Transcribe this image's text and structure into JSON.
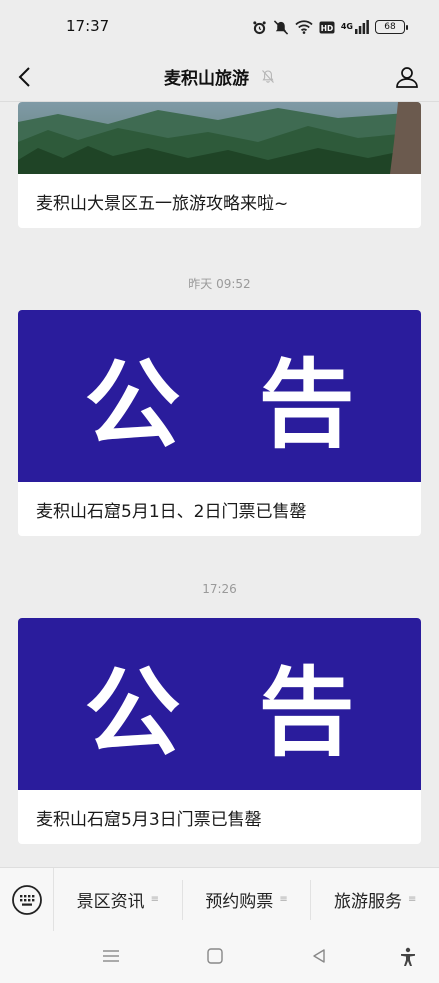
{
  "status_bar": {
    "time": "17:37",
    "network_label": "4G",
    "battery": "68",
    "icons": [
      "alarm-icon",
      "mute-icon",
      "wifi-icon",
      "hd-icon",
      "signal-icon",
      "battery-icon"
    ]
  },
  "header": {
    "title": "麦积山旅游",
    "icons": [
      "back-icon",
      "mute-bell-icon",
      "profile-icon"
    ]
  },
  "feed": [
    {
      "type": "image",
      "caption": "麦积山大景区五一旅游攻略来啦~"
    },
    {
      "timestamp": "昨天 09:52",
      "banner_left": "公",
      "banner_right": "告",
      "caption": "麦积山石窟5月1日、2日门票已售罄"
    },
    {
      "timestamp": "17:26",
      "banner_left": "公",
      "banner_right": "告",
      "caption": "麦积山石窟5月3日门票已售罄"
    }
  ],
  "bottom_menu": {
    "keyboard_icon": "keyboard-icon",
    "items": [
      {
        "label": "景区资讯"
      },
      {
        "label": "预约购票"
      },
      {
        "label": "旅游服务"
      }
    ],
    "menu_marker": "≡"
  },
  "system_nav": [
    "menu-icon",
    "home-icon",
    "back-triangle-icon",
    "accessibility-icon"
  ],
  "colors": {
    "banner": "#2a1c9c",
    "background": "#ededed"
  }
}
